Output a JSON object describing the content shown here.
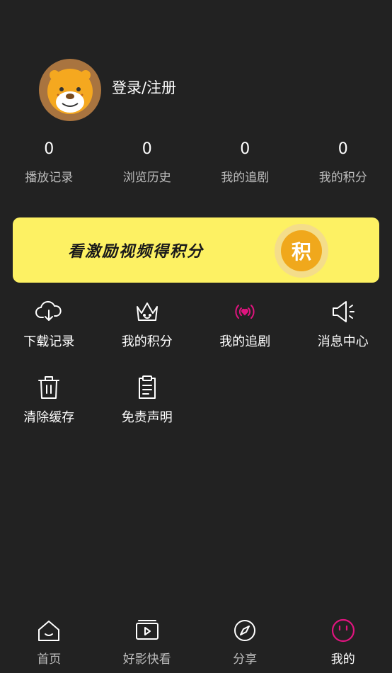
{
  "profile": {
    "login_label": "登录/注册"
  },
  "stats": [
    {
      "value": "0",
      "label": "播放记录"
    },
    {
      "value": "0",
      "label": "浏览历史"
    },
    {
      "value": "0",
      "label": "我的追剧"
    },
    {
      "value": "0",
      "label": "我的积分"
    }
  ],
  "banner": {
    "text": "看激励视频得积分",
    "coin_label": "积"
  },
  "menu": [
    {
      "label": "下载记录",
      "icon": "cloud-download-icon"
    },
    {
      "label": "我的积分",
      "icon": "crown-icon"
    },
    {
      "label": "我的追剧",
      "icon": "broadcast-heart-icon"
    },
    {
      "label": "消息中心",
      "icon": "speaker-icon"
    },
    {
      "label": "清除缓存",
      "icon": "trash-icon"
    },
    {
      "label": "免责声明",
      "icon": "clipboard-icon"
    }
  ],
  "nav": [
    {
      "label": "首页",
      "icon": "home-icon"
    },
    {
      "label": "好影快看",
      "icon": "video-icon"
    },
    {
      "label": "分享",
      "icon": "compass-icon"
    },
    {
      "label": "我的",
      "icon": "smile-icon",
      "active": true
    }
  ],
  "colors": {
    "background": "#222222",
    "accent": "#e0147f",
    "banner": "#fdf163",
    "coin": "#f0a81c"
  }
}
